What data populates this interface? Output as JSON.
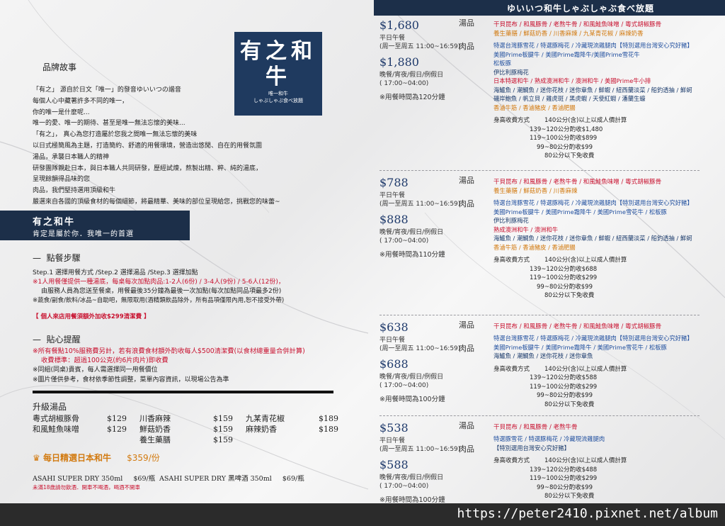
{
  "banner": {
    "title": "ゆいいつ和牛しゃぶしゃぶ食べ放題"
  },
  "logo": {
    "name": "有之和牛",
    "sub1": "唯一和牛",
    "sub2": "しゃぶしゃぶ食べ放題"
  },
  "story": {
    "heading": "品牌故事",
    "lines": [
      "「有之」 源自於日文「唯一」的發音ゆいいつの諧音",
      "每個人心中藏著許多不同的唯一，",
      "你的唯一是什麼呢...",
      "唯一的愛、唯一的期待、甚至是唯一無法忘懷的美味...",
      "「有之」， 真心為您打造屬於您我之間唯一無法忘懷的美味",
      "以日式極簡風為主題，打造簡約、舒適的用餐環境，營造出悠閒、自在的用餐氛圍",
      "湯品，承襲日本職人的精神",
      "研發團隊親赴日本，與日本職人共同研發，歷經試煉，熬製出精、粹、純的湯底，",
      "呈現餘韻得品味的您",
      "肉品，我們堅持選用頂級和牛",
      "嚴選來自各國的頂級食材的每個細節，將最精華、美味的部位呈現給您，挑戰您的味蕾~"
    ]
  },
  "band": {
    "title": "有之和牛",
    "slogan": "肯定是屬於你．我唯一的首選"
  },
  "steps": {
    "heading": "點餐步驟",
    "line1": "Step.1 選擇用餐方式  /Step.2 選擇湯品  /Step.3 選擇加點",
    "line2": "※1人用餐僅提供一種湯底，每桌每次加點肉品:1-2人(6份) / 3-4人(9份) / 5-6人(12份)，",
    "line3": "由服務人員為您送至餐桌，用餐最後35分鐘為最後一次加點(每次加點同品項最多2份)",
    "line4": "※蔬食/副食/飲料/冰品~自助吧，無限取用(酒精類飲品除外，所有品項僅限內用,恕不接受外帶)",
    "notice": "【 個人來店用餐須額外加收$299清潔費 】"
  },
  "tips": {
    "heading": "貼心提醒",
    "line1": "※所有餐點10%服務費另計，若有浪費食材額外酌收每人$500清潔費(以食材總重量合併計算)",
    "line2": "收費標準：超過100公克(約6片肉片)即收費",
    "line3": "※同組(同桌)貴賓，每人需選擇同一用餐價位",
    "line4": "※圖片僅供參考，食材依季節性調整，菜單內容資訊，以現場公告為準"
  },
  "upgrade": {
    "heading": "升級湯品",
    "items": [
      {
        "name": "粵式胡椒豚骨",
        "price": "$129"
      },
      {
        "name": "川香麻辣",
        "price": "$159"
      },
      {
        "name": "九某青花椒",
        "price": "$189"
      },
      {
        "name": "和風鮭魚味噌",
        "price": "$129"
      },
      {
        "name": "鮮菇奶香",
        "price": "$159"
      },
      {
        "name": "麻辣奶香",
        "price": "$189"
      },
      {
        "name": "",
        "price": ""
      },
      {
        "name": "養生藥膳",
        "price": "$159"
      },
      {
        "name": "",
        "price": ""
      }
    ],
    "wagyu_label": "每日精選日本和牛",
    "wagyu_price": "$359/份",
    "beer1": "ASAHI SUPER DRY 350ml",
    "beer1_price": "$69/瓶",
    "beer2": "ASAHI SUPER DRY 黑啤酒 350ml",
    "beer2_price": "$69/瓶",
    "age_note": "未滿18歲請勿飲酒．開車不喝酒，喝酒不開車"
  },
  "labels": {
    "soup": "湯品",
    "meat": "肉品",
    "fee_title": "身高收費方式"
  },
  "plans": [
    {
      "lunch_price": "$1,680",
      "lunch_label": "平日午餐",
      "lunch_time": "(周一至周五 11:00~16:59)",
      "dinner_price": "$1,880",
      "dinner_label": "晚餐/宵夜/假日/例假日",
      "dinner_time": "( 17:00~04:00)",
      "limit": "※用餐時間為120分鐘",
      "soup_red": "干貝昆布 / 和風豚骨 / 老熬牛骨 / 和風鮭魚味噌 / 粵式胡椒豚骨",
      "soup_orange": "養生藥膳 / 鮮菇奶香 / 川香麻辣 / 九某青花椒 / 麻辣奶香",
      "meat_lines": [
        {
          "c": "blue",
          "t": "特選台灣豚雪花 / 特選豚梅花 / 冷藏現流雞腿肉【特別選用台灣安心究好豬】"
        },
        {
          "c": "blue",
          "t": "美國Prime板腱牛 / 美國Prime霜降牛/美國Prime雪花牛"
        },
        {
          "c": "blue",
          "t": "松板豚"
        },
        {
          "c": "navy",
          "t": "伊比利豚梅花"
        },
        {
          "c": "red",
          "t": "日本特選和牛 / 熟成澳洲和牛 / 澳洲和牛 / 美國Prime牛小排"
        },
        {
          "c": "navy",
          "t": "海鱸魚 / 潮鯛魚 / 迷你花枝 / 迷你章魚 / 鮮蝦 / 紐西蘭淡菜 / 船釣透抽 / 鮮蚵"
        },
        {
          "c": "navy",
          "t": "磯岸鮑魚 / 帆立貝 / 雞虎斑 / 黑虎蝦 / 天使紅蝦 / 潘蘭生蠔"
        },
        {
          "c": "orange",
          "t": "香滷牛筋 / 香滷豬皮 / 香滷肥腸"
        }
      ],
      "fees": [
        "140公分(含)以上以成人價計算",
        "139~120公分酌收$1,480",
        "119~100公分酌收$899",
        "99~80公分酌收$99",
        "80公分以下免收費"
      ]
    },
    {
      "lunch_price": "$788",
      "lunch_label": "平日午餐",
      "lunch_time": "(周一至周五 11:00~16:59)",
      "dinner_price": "$888",
      "dinner_label": "晚餐/宵夜/假日/例假日",
      "dinner_time": "( 17:00~04:00)",
      "limit": "※用餐時間為110分鐘",
      "soup_red": "干貝昆布 / 和風豚骨 / 老熬牛骨 / 和風鮭魚味噌 / 粵式胡椒豚骨",
      "soup_orange": "養生藥膳 / 鮮菇奶香 / 川香麻辣",
      "meat_lines": [
        {
          "c": "blue",
          "t": "特選台灣豚雪花 / 特選豚梅花 / 冷藏現流雞腿肉【特別選用台灣安心究好豬】"
        },
        {
          "c": "blue",
          "t": "美國Prime板腱牛 / 美國Prime霜降牛 / 美國Prime雪花牛 / 松板豚"
        },
        {
          "c": "navy",
          "t": "伊比利豚梅花"
        },
        {
          "c": "red",
          "t": "熟成澳洲和牛 / 澳洲和牛"
        },
        {
          "c": "navy",
          "t": "海鱸魚 / 潮鯛魚 / 迷你花枝 / 迷你章魚 / 鮮蝦 / 紐西蘭淡菜 / 船釣透抽 / 鮮蚵"
        },
        {
          "c": "orange",
          "t": "香滷牛筋 / 香滷豬皮 / 香滷肥腸"
        }
      ],
      "fees": [
        "140公分(含)以上以成人價計算",
        "139~120公分酌收$688",
        "119~100公分酌收$299",
        "99~80公分酌收$99",
        "80公分以下免收費"
      ]
    },
    {
      "lunch_price": "$638",
      "lunch_label": "平日午餐",
      "lunch_time": "(周一至周五 11:00~16:59)",
      "dinner_price": "$688",
      "dinner_label": "晚餐/宵夜/假日/例假日",
      "dinner_time": "( 17:00~04:00)",
      "limit": "※用餐時間為100分鐘",
      "soup_red": "干貝昆布 / 和風豚骨 / 老熬牛骨 / 和風鮭魚味噌 / 粵式胡椒豚骨",
      "soup_orange": "",
      "meat_lines": [
        {
          "c": "blue",
          "t": "特選台灣豚雪花 / 特選豚梅花 / 冷藏現流雞腿肉【特別選用台灣安心究好豬】"
        },
        {
          "c": "blue",
          "t": "美國Prime板腱牛 / 美國Prime霜降牛 / 美國Prime雪花牛 / 松板豚"
        },
        {
          "c": "navy",
          "t": "海鱸魚 / 潮鯛魚 / 迷你花枝 / 迷你章魚"
        }
      ],
      "fees": [
        "140公分(含)以上以成人價計算",
        "139~120公分酌收$588",
        "119~100公分酌收$299",
        "99~80公分酌收$99",
        "80公分以下免收費"
      ]
    },
    {
      "lunch_price": "$538",
      "lunch_label": "平日午餐",
      "lunch_time": "(周一至周五 11:00~16:59)",
      "dinner_price": "$588",
      "dinner_label": "晚餐/宵夜/假日/例假日",
      "dinner_time": "( 17:00~04:00)",
      "limit": "※用餐時間為100分鐘",
      "soup_red": "干貝昆布 / 和風豚骨 / 老熬牛骨",
      "soup_orange": "",
      "meat_lines": [
        {
          "c": "blue",
          "t": "特選豚雪花 / 特選豚梅花 / 冷藏現流雞腿肉"
        },
        {
          "c": "navy",
          "t": "【特別選用台灣安心究好豬】"
        }
      ],
      "fees": [
        "140公分(含)以上以成人價計算",
        "139~120公分酌收$488",
        "119~100公分酌收$299",
        "99~80公分酌收$99",
        "80公分以下免收費"
      ]
    }
  ],
  "watermark": "https://peter2410.pixnet.net/album"
}
